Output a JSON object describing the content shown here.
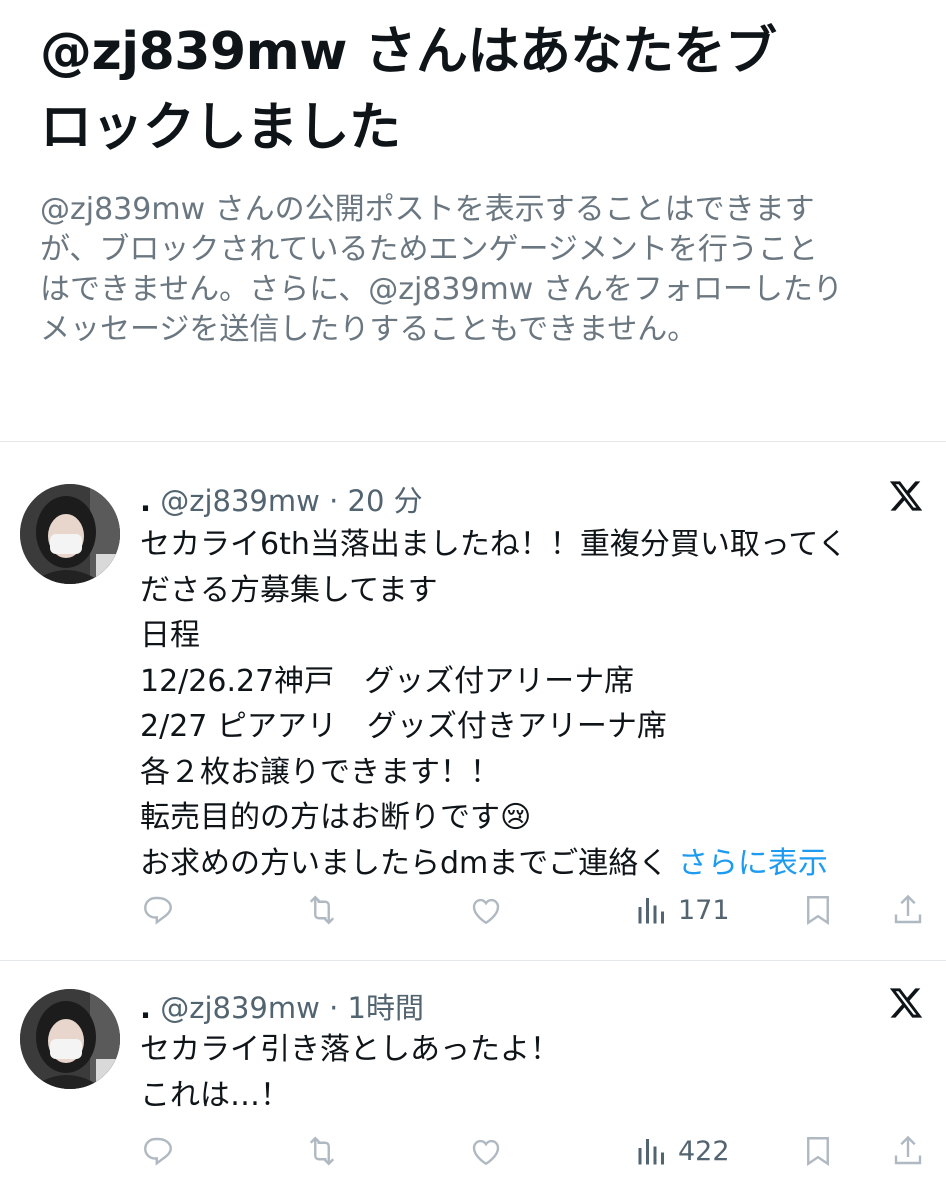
{
  "blocked": {
    "title_lines": [
      "@zj839mw さんはあなたをブ",
      "ロックしました"
    ],
    "description_lines": [
      "@zj839mw さんの公開ポストを表示することはできます",
      "が、ブロックされているためエンゲージメントを行うこと",
      "はできません。さらに、@zj839mw さんをフォローしたり",
      "メッセージを送信したりすることもできません。"
    ]
  },
  "posts": [
    {
      "display_name": ".",
      "handle": "@zj839mw",
      "time": "20 分",
      "lines": [
        "セカライ6th当落出ましたね！！重複分買い取ってく",
        "ださる方募集してます",
        "日程",
        "12/26.27神戸　グッズ付アリーナ席",
        "2/27 ピアアリ　グッズ付きアリーナ席",
        "各２枚お譲りできます！！",
        "転売目的の方はお断りです😢",
        "お求めの方いましたらdmまでご連絡く"
      ],
      "show_more": "さらに表示",
      "views": "171"
    },
    {
      "display_name": ".",
      "handle": "@zj839mw",
      "time": "1時間",
      "lines": [
        "セカライ引き落としあったよ！",
        "これは…！"
      ],
      "views": "422"
    }
  ],
  "icons": {
    "reply": "reply-icon",
    "repost": "repost-icon",
    "like": "like-icon",
    "views": "views-icon",
    "bookmark": "bookmark-icon",
    "share": "share-icon",
    "brand": "x-logo-icon"
  },
  "colors": {
    "link": "#1d9bf0",
    "muted": "#6b7780",
    "action": "#8b98a5"
  }
}
